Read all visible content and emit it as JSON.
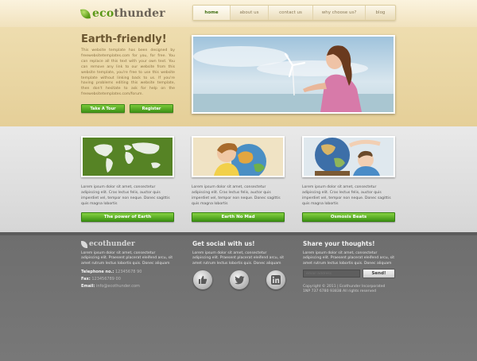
{
  "brand": {
    "name_part1": "eco",
    "name_part2": "thunder"
  },
  "nav": {
    "items": [
      "home",
      "about us",
      "contact us",
      "why choose us?",
      "blog"
    ],
    "active": "home"
  },
  "hero": {
    "title": "Earth-friendly!",
    "text": "This website template has been designed by freewebsitetemplates.com for you, for free. You can replace all this text with your own text. You can remove any link to our website from this website template, you're free to use this website template without linking back to us. If you're having problems editing this website template, then don't hesitate to ask for help on the freewebsitetemplates.com/forum.",
    "btn_tour": "Take A Tour",
    "btn_register": "Register"
  },
  "features": [
    {
      "text": "Lorem ipsum dolor sit amet, consectetur adipiscing elit. Cras lectus felis, auctor quis imperdiet vel, tempor non neque. Donec sagittis quis magna lobortis",
      "button": "The power of Earth"
    },
    {
      "text": "Lorem ipsum dolor sit amet, consectetur adipiscing elit. Cras lectus felis, auctor quis imperdiet vel, tempor non neque. Donec sagittis quis magna lobortis",
      "button": "Earth No Mad"
    },
    {
      "text": "Lorem ipsum dolor sit amet, consectetur adipiscing elit. Cras lectus felis, auctor quis imperdiet vel, tempor non neque. Donec sagittis quis magna lobortis",
      "button": "Osmosis Beats"
    }
  ],
  "footer": {
    "logo_part1": "eco",
    "logo_part2": "thunder",
    "about_text": "Lorem ipsum dolor sit amet, consectetur adipiscing elit. Praesent placerat eleifend arcu, sit amet rutrum lectus lobortis quis. Donec aliquam",
    "telephone_label": "Telephone no.:",
    "telephone_value": "12345678 90",
    "fax_label": "Fax:",
    "fax_value": "123456789 00",
    "email_label": "Email:",
    "email_value": "info@ecothunder.com",
    "social_heading": "Get social with us!",
    "social_text": "Lorem ipsum dolor sit amet, consectetur adipiscing elit. Praesent placerat eleifend arcu, sit amet rutrum lectus lobortis quis. Donec aliquam",
    "share_heading": "Share your thoughts!",
    "share_text": "Lorem ipsum dolor sit amet, consectetur adipiscing elit. Praesent placerat eleifend arcu, sit amet rutrum lectus lobortis quis. Donec aliquam",
    "email_placeholder": "email address",
    "send_label": "Send!",
    "copyright_line1": "Copyright © 2011 | Ecothunder Incorporated",
    "copyright_line2": "1NP 737 6780 93838 All rights reserved"
  },
  "colors": {
    "accent_green": "#4ea51e",
    "hero_bg": "#eadaa9",
    "footer_bg": "#707070"
  },
  "icons": {
    "social": [
      "thumbs-up-icon",
      "twitter-bird-icon",
      "linkedin-icon"
    ]
  }
}
